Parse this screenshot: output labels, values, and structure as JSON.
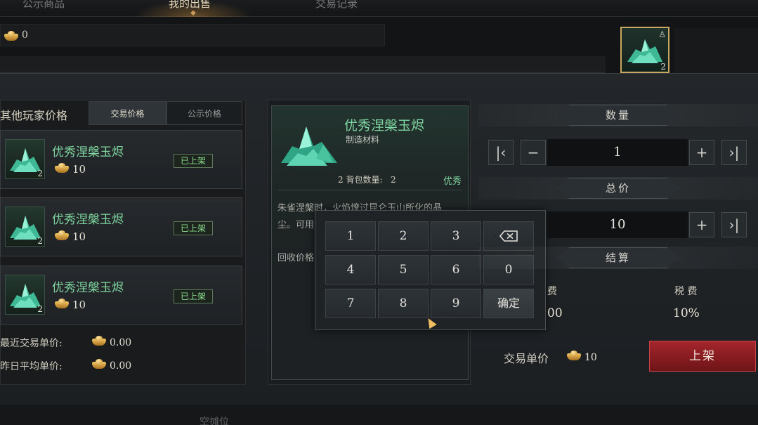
{
  "tabs": [
    {
      "label": "公示商品"
    },
    {
      "label": "我的出售"
    },
    {
      "label": "交易记录"
    }
  ],
  "currency": {
    "amount": "0"
  },
  "inventory_slot": {
    "count": "2"
  },
  "left_panel": {
    "title": "其他玩家价格",
    "segments": [
      "交易价格",
      "公示价格"
    ],
    "listings": [
      {
        "name": "优秀涅槃玉烬",
        "count": "2",
        "price": "10",
        "status": "已上架"
      },
      {
        "name": "优秀涅槃玉烬",
        "count": "2",
        "price": "10",
        "status": "已上架"
      },
      {
        "name": "优秀涅槃玉烬",
        "count": "2",
        "price": "10",
        "status": "已上架"
      }
    ],
    "recent_label": "最近交易单价:",
    "recent_value": "0.00",
    "avg_label": "昨日平均单价:",
    "avg_value": "0.00"
  },
  "item": {
    "name": "优秀涅槃玉烬",
    "type": "制造材料",
    "bag_label": "2 背包数量:",
    "bag_count": "2",
    "quality": "优秀",
    "desc_line1": "朱雀涅槃时，火焰燎过昆仑玉山所化的晶",
    "desc_line2": "尘。可用",
    "recycle_label": "回收价格"
  },
  "numpad": {
    "keys": [
      "1",
      "2",
      "3",
      "4",
      "5",
      "6",
      "0",
      "7",
      "8",
      "9"
    ],
    "confirm": "确定"
  },
  "right_panel": {
    "quantity_header": "数量",
    "quantity": "1",
    "total_header": "总价",
    "total": "10",
    "settle_header": "结算",
    "fee_label": "费",
    "fee_value": "00",
    "tax_label": "税 费",
    "tax_value": "10%",
    "unit_price_label": "交易单价",
    "unit_price_value": "10",
    "list_button": "上架"
  },
  "bottom_label": "空摊位",
  "colors": {
    "item_green": "#7fd6a0",
    "list_button_red": "#a3262b",
    "gold": "#e0a84a"
  }
}
